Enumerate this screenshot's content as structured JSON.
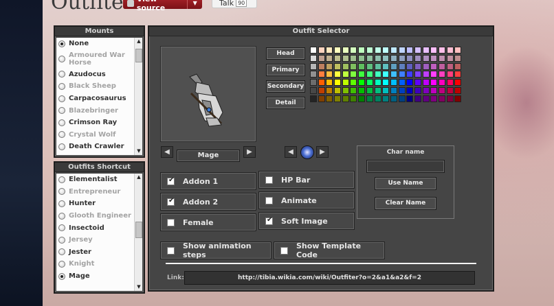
{
  "page": {
    "title": "Outfiter",
    "view_source_label": "View source",
    "talk_label": "Talk",
    "talk_count": "90"
  },
  "mounts": {
    "header": "Mounts",
    "items": [
      {
        "label": "None",
        "selected": true,
        "dim": false
      },
      {
        "label": "Armoured War Horse",
        "selected": false,
        "dim": true
      },
      {
        "label": "Azudocus",
        "selected": false,
        "dim": false
      },
      {
        "label": "Black Sheep",
        "selected": false,
        "dim": true
      },
      {
        "label": "Carpacosaurus",
        "selected": false,
        "dim": false
      },
      {
        "label": "Blazebringer",
        "selected": false,
        "dim": true
      },
      {
        "label": "Crimson Ray",
        "selected": false,
        "dim": false
      },
      {
        "label": "Crystal Wolf",
        "selected": false,
        "dim": true
      },
      {
        "label": "Death Crawler",
        "selected": false,
        "dim": false
      }
    ]
  },
  "outfits": {
    "header": "Outfits Shortcut",
    "items": [
      {
        "label": "Elementalist",
        "selected": false,
        "dim": false
      },
      {
        "label": "Entrepreneur",
        "selected": false,
        "dim": true
      },
      {
        "label": "Hunter",
        "selected": false,
        "dim": false
      },
      {
        "label": "Glooth Engineer",
        "selected": false,
        "dim": true
      },
      {
        "label": "Insectoid",
        "selected": false,
        "dim": false
      },
      {
        "label": "Jersey",
        "selected": false,
        "dim": true
      },
      {
        "label": "Jester",
        "selected": false,
        "dim": false
      },
      {
        "label": "Knight",
        "selected": false,
        "dim": true
      },
      {
        "label": "Mage",
        "selected": true,
        "dim": false
      }
    ]
  },
  "selector": {
    "header": "Outfit Selector",
    "outfit_name": "Mage",
    "parts": [
      "Head",
      "Primary",
      "Secondary",
      "Detail"
    ],
    "options": {
      "addon1": {
        "label": "Addon 1",
        "checked": true
      },
      "addon2": {
        "label": "Addon 2",
        "checked": true
      },
      "female": {
        "label": "Female",
        "checked": false
      },
      "hp_bar": {
        "label": "HP Bar",
        "checked": false
      },
      "animate": {
        "label": "Animate",
        "checked": false
      },
      "soft_image": {
        "label": "Soft Image",
        "checked": true
      },
      "show_steps": {
        "label": "Show animation steps",
        "checked": false
      },
      "show_template": {
        "label": "Show Template Code",
        "checked": false
      }
    },
    "char": {
      "title": "Char name",
      "value": "",
      "use_name": "Use Name",
      "clear_name": "Clear Name"
    },
    "link_label": "Link:",
    "link_value": "http://tibia.wikia.com/wiki/Outfiter?o=2&a1&a2&f=2"
  },
  "palette": {
    "rows": [
      [
        "#ffffff",
        "#ffd4bf",
        "#ffe9bf",
        "#ffffbf",
        "#e9ffbf",
        "#d4ffbf",
        "#bfffbf",
        "#bfffd4",
        "#bfffe9",
        "#bfffff",
        "#bfe9ff",
        "#bfd4ff",
        "#bfbfff",
        "#d4bfff",
        "#e9bfff",
        "#ffbfff",
        "#ffbfe9",
        "#ffbfd4",
        "#ffbfbf"
      ],
      [
        "#dadada",
        "#bf9f8f",
        "#bfaf8f",
        "#bfbf8f",
        "#afbf8f",
        "#9fbf8f",
        "#8fbf8f",
        "#8fbf9f",
        "#8fbfaf",
        "#8fbfbf",
        "#8fafbf",
        "#8f9fbf",
        "#8f8fbf",
        "#9f8fbf",
        "#af8fbf",
        "#bf8fbf",
        "#bf8faf",
        "#bf8f9f",
        "#bf8f8f"
      ],
      [
        "#b6b6b6",
        "#bf7f5f",
        "#bf9f5f",
        "#bfbf5f",
        "#9fbf5f",
        "#7fbf5f",
        "#5fbf5f",
        "#5fbf7f",
        "#5fbf9f",
        "#5fbfbf",
        "#5f9fbf",
        "#5f7fbf",
        "#5f5fbf",
        "#7f5fbf",
        "#9f5fbf",
        "#bf5fbf",
        "#bf5f9f",
        "#bf5f7f",
        "#bf5f5f"
      ],
      [
        "#919191",
        "#ff7f3f",
        "#ffbf3f",
        "#ffff3f",
        "#bfff3f",
        "#7fff3f",
        "#3fff3f",
        "#3fff7f",
        "#3fffbf",
        "#3fffff",
        "#3fbfff",
        "#3f7fff",
        "#3f3fff",
        "#7f3fff",
        "#bf3fff",
        "#ff3fff",
        "#ff3fbf",
        "#ff3f7f",
        "#ff3f3f"
      ],
      [
        "#6d6d6d",
        "#ff5f00",
        "#ffbf00",
        "#ffff00",
        "#bfff00",
        "#5fff00",
        "#00ff00",
        "#00ff5f",
        "#00ffbf",
        "#00ffff",
        "#00bfff",
        "#005fff",
        "#0000ff",
        "#5f00ff",
        "#bf00ff",
        "#ff00ff",
        "#ff00bf",
        "#ff005f",
        "#ff0000"
      ],
      [
        "#484848",
        "#bf3f00",
        "#bf7f00",
        "#bfbf00",
        "#7fbf00",
        "#3fbf00",
        "#00bf00",
        "#00bf3f",
        "#00bf7f",
        "#00bfbf",
        "#007fbf",
        "#003fbf",
        "#0000bf",
        "#3f00bf",
        "#7f00bf",
        "#bf00bf",
        "#bf007f",
        "#bf003f",
        "#bf0000"
      ],
      [
        "#242424",
        "#7f3f00",
        "#7f5f00",
        "#7f7f00",
        "#5f7f00",
        "#3f7f00",
        "#007f00",
        "#007f3f",
        "#007f5f",
        "#007f7f",
        "#005f7f",
        "#003f7f",
        "#00007f",
        "#3f007f",
        "#5f007f",
        "#7f007f",
        "#7f005f",
        "#7f003f",
        "#7f0000"
      ]
    ]
  }
}
